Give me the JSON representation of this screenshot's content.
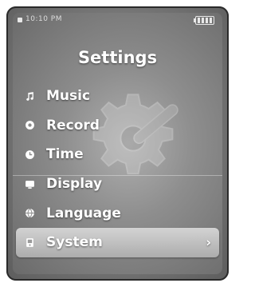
{
  "status_bar": {
    "time": "10:10 PM"
  },
  "title": "Settings",
  "menu": {
    "items": [
      {
        "label": "Music",
        "icon": "music-note-icon"
      },
      {
        "label": "Record",
        "icon": "record-icon"
      },
      {
        "label": "Time",
        "icon": "clock-icon"
      },
      {
        "label": "Display",
        "icon": "display-icon"
      },
      {
        "label": "Language",
        "icon": "globe-icon"
      },
      {
        "label": "System",
        "icon": "system-icon",
        "selected": true
      }
    ],
    "selected_chevron": "›"
  },
  "colors": {
    "screen_background": "#8e8e8e",
    "text": "#ffffff",
    "selection_highlight": "#cfcfcf"
  }
}
